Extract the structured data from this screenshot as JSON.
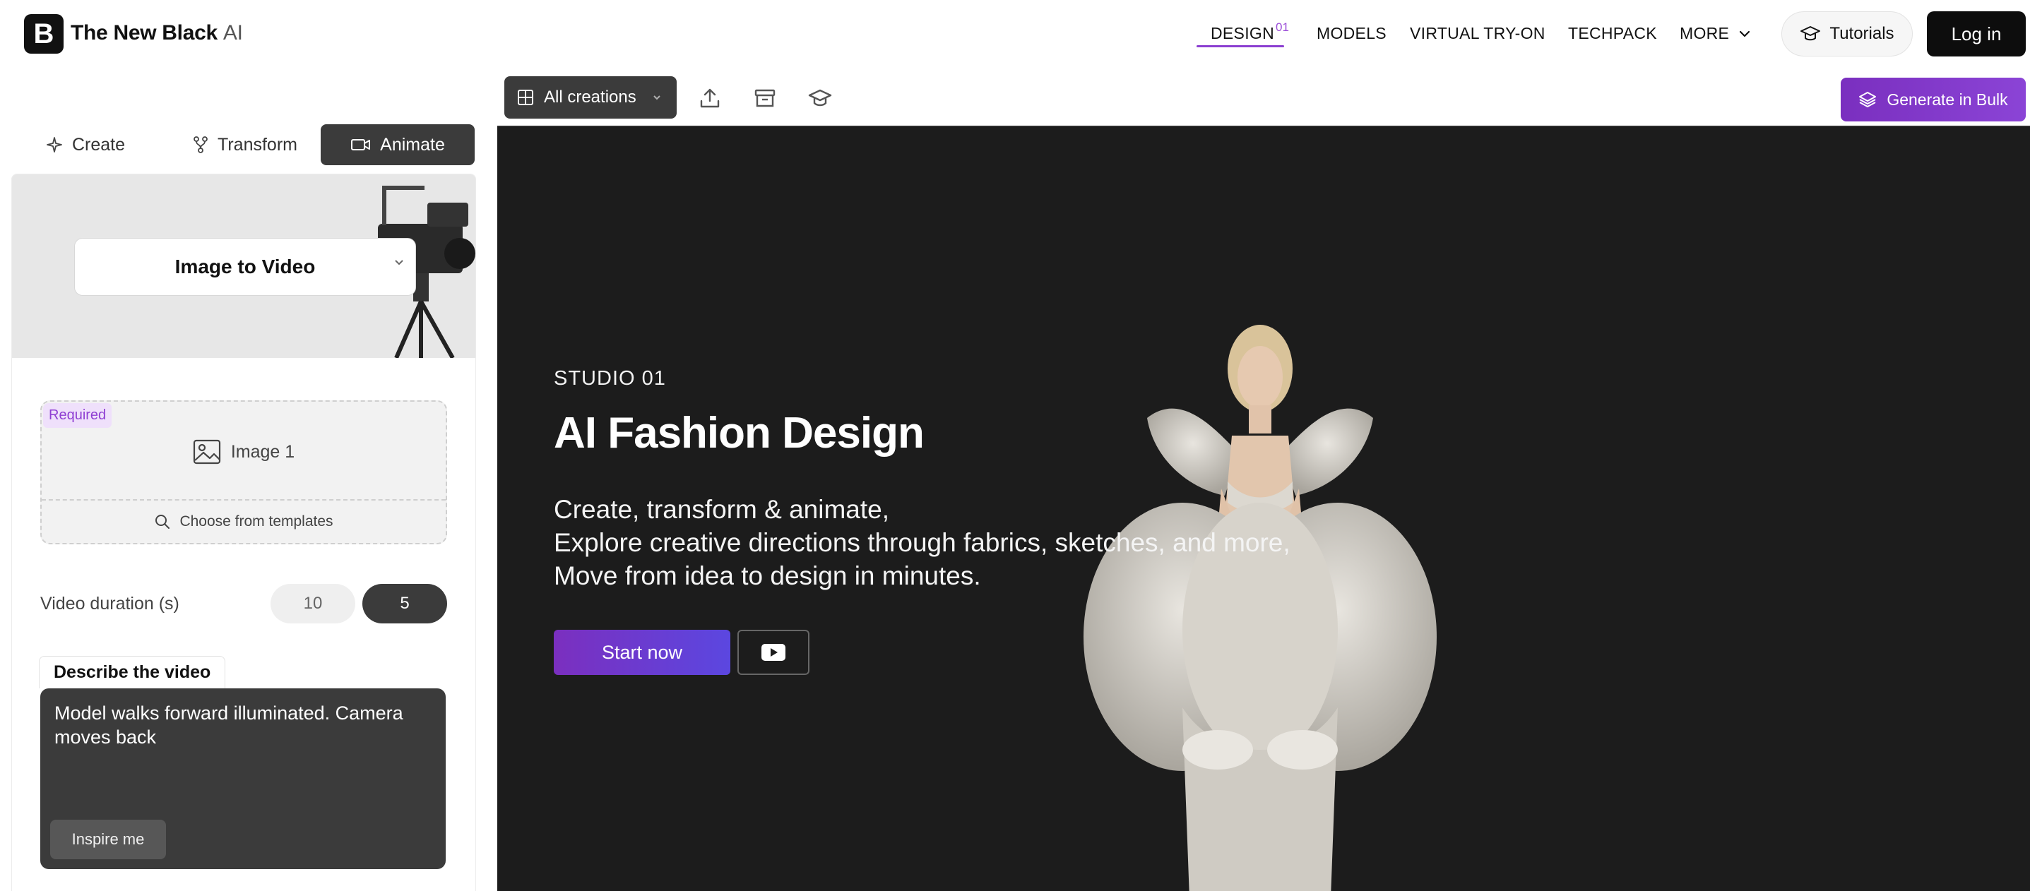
{
  "header": {
    "brand": "The New Black",
    "brand_suffix": "AI",
    "logo_letter": "B",
    "nav": {
      "design": "DESIGN",
      "design_sup": "01",
      "models": "MODELS",
      "virtual_try_on": "VIRTUAL TRY-ON",
      "techpack": "TECHPACK",
      "more": "MORE"
    },
    "tutorials": "Tutorials",
    "login": "Log in"
  },
  "toolbar": {
    "all_creations": "All creations",
    "generate_bulk": "Generate in Bulk"
  },
  "tabs": {
    "create": "Create",
    "transform": "Transform",
    "animate": "Animate",
    "active": "animate"
  },
  "panel": {
    "mode": "Image to Video",
    "required_badge": "Required",
    "image_slot": "Image 1",
    "choose_templates": "Choose from templates",
    "duration_label": "Video duration (s)",
    "duration_options": [
      "10",
      "5"
    ],
    "duration_selected": "5",
    "describe_label": "Describe the video",
    "describe_text": "Model walks forward illuminated. Camera moves back",
    "inspire": "Inspire me"
  },
  "hero": {
    "kicker": "STUDIO 01",
    "title": "AI Fashion Design",
    "lines": [
      "Create, transform & animate,",
      "Explore creative directions through fabrics, sketches, and more,",
      "Move from idea to design in minutes."
    ],
    "cta": "Start now"
  },
  "colors": {
    "accent_purple": "#8b3fd1",
    "dark_surface": "#1c1c1c",
    "button_dark": "#3b3b3b"
  }
}
